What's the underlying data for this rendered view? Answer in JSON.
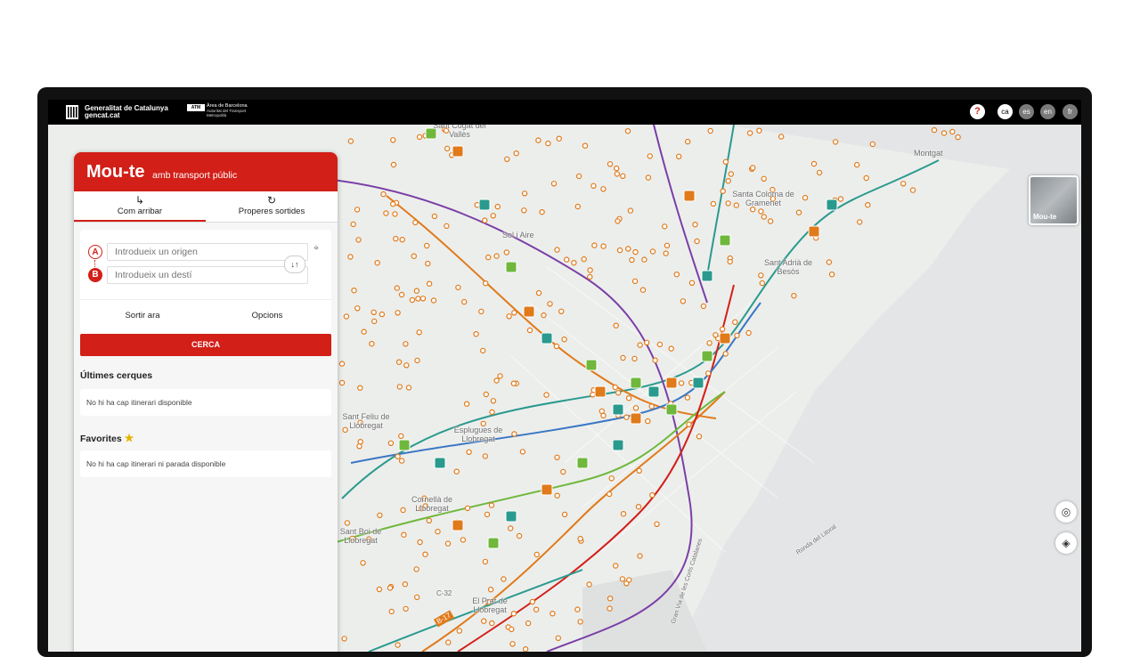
{
  "header": {
    "gov_name": "Generalitat de Catalunya",
    "gov_site": "gencat.cat",
    "atm_logo": "ATM",
    "atm_name": "Àrea de Barcelona",
    "atm_desc": "Autoritat del Transport Metropolità",
    "help": "?",
    "languages": [
      "ca",
      "es",
      "en",
      "fr"
    ],
    "active_language": "ca"
  },
  "panel": {
    "title": "Mou-te",
    "subtitle": "amb transport públic",
    "tabs": [
      {
        "label": "Com arribar",
        "icon": "directions-icon",
        "active": true
      },
      {
        "label": "Properes sortides",
        "icon": "clock-icon",
        "active": false
      }
    ],
    "origin_letter": "A",
    "destination_letter": "B",
    "origin_placeholder": "Introdueix un origen",
    "destination_placeholder": "Introdueix un destí",
    "swap_symbol": "↓↑",
    "depart_now": "Sortir ara",
    "options": "Opcions",
    "search": "CERCA",
    "recent_title": "Últimes cerques",
    "recent_empty": "No hi ha cap itinerari disponible",
    "favorites_title": "Favorites",
    "favorites_empty": "No hi ha cap itinerari ni parada disponible"
  },
  "map": {
    "basemap_label": "Mou-te",
    "places": [
      "Sant Cugat del Vallès",
      "Montgat",
      "Santa Coloma de Gramenet",
      "Sol i Aire",
      "Sant Adrià de Besòs",
      "Sant Feliu de Llobregat",
      "Esplugues de Llobregat",
      "Cornellà de Llobregat",
      "Sant Boi de Llobregat",
      "El Prat de Llobregat",
      "Ronda del Litoral",
      "Gran Via de les Corts Catalanes",
      "C-32",
      "B-17"
    ],
    "controls": [
      "locate-icon",
      "layers-icon"
    ]
  },
  "colors": {
    "brand_red": "#d21f18",
    "map_land": "#eceeec",
    "sea": "#e3e5e6"
  }
}
